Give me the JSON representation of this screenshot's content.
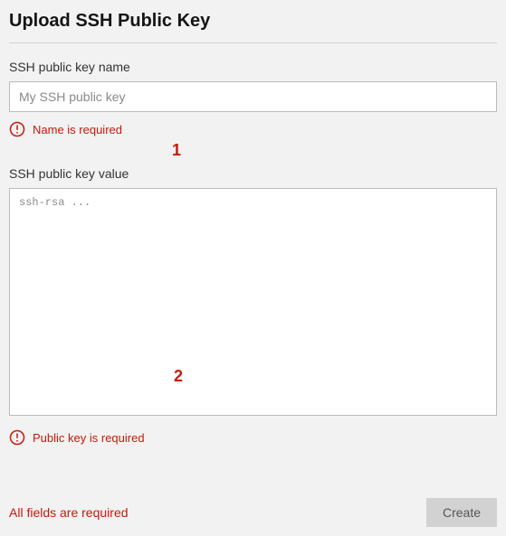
{
  "title": "Upload SSH Public Key",
  "fields": {
    "name": {
      "label": "SSH public key name",
      "placeholder": "My SSH public key",
      "value": "",
      "error": "Name is required"
    },
    "value": {
      "label": "SSH public key value",
      "placeholder": "ssh-rsa ...",
      "value": "",
      "error": "Public key is required"
    }
  },
  "footer": {
    "error": "All fields are required",
    "create_label": "Create"
  },
  "annotations": {
    "one": "1",
    "two": "2"
  },
  "colors": {
    "error": "#c9190b",
    "background": "#f2f2f2"
  }
}
